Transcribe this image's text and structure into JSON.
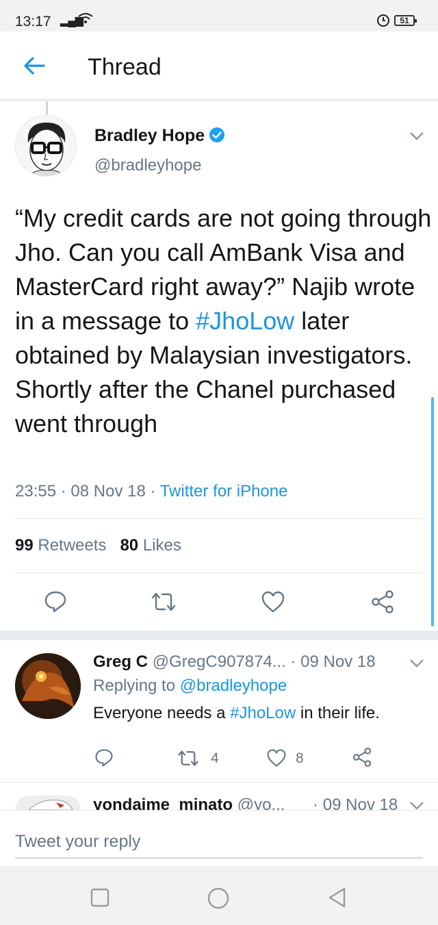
{
  "status_bar": {
    "time": "13:17",
    "battery": "51"
  },
  "header": {
    "title": "Thread"
  },
  "main_tweet": {
    "name": "Bradley Hope",
    "handle": "@bradleyhope",
    "text_before": "“My credit cards are not going through Jho. Can you call AmBank Visa and MasterCard right away?” Najib wrote in a message to ",
    "hashtag": "#JhoLow",
    "text_after": " later obtained by Malaysian investigators. Shortly after the Chanel purchased went through",
    "time": "23:55",
    "date": "08 Nov 18",
    "source": "Twitter for iPhone",
    "retweets": "99",
    "retweets_label": "Retweets",
    "likes": "80",
    "likes_label": "Likes",
    "sep": "·"
  },
  "replies": [
    {
      "name": "Greg C",
      "handle": "@GregC907874...",
      "date": "· 09 Nov 18",
      "replying_prefix": "Replying to",
      "replying_to": "@bradleyhope",
      "text_before": "Everyone needs a ",
      "hashtag": "#JhoLow",
      "text_after": " in their life.",
      "retweets": "4",
      "likes": "8"
    },
    {
      "name": "yondaime_minato",
      "handle": "@yo...",
      "date": "· 09 Nov 18"
    }
  ],
  "composer": {
    "placeholder": "Tweet your reply"
  },
  "colors": {
    "accent": "#1b95e0",
    "muted": "#657786",
    "text": "#14171a"
  },
  "icons": [
    "back-arrow-icon",
    "verified-badge-icon",
    "chevron-down-icon",
    "reply-icon",
    "retweet-icon",
    "like-icon",
    "share-icon",
    "nav-recent-icon",
    "nav-home-icon",
    "nav-back-icon"
  ]
}
